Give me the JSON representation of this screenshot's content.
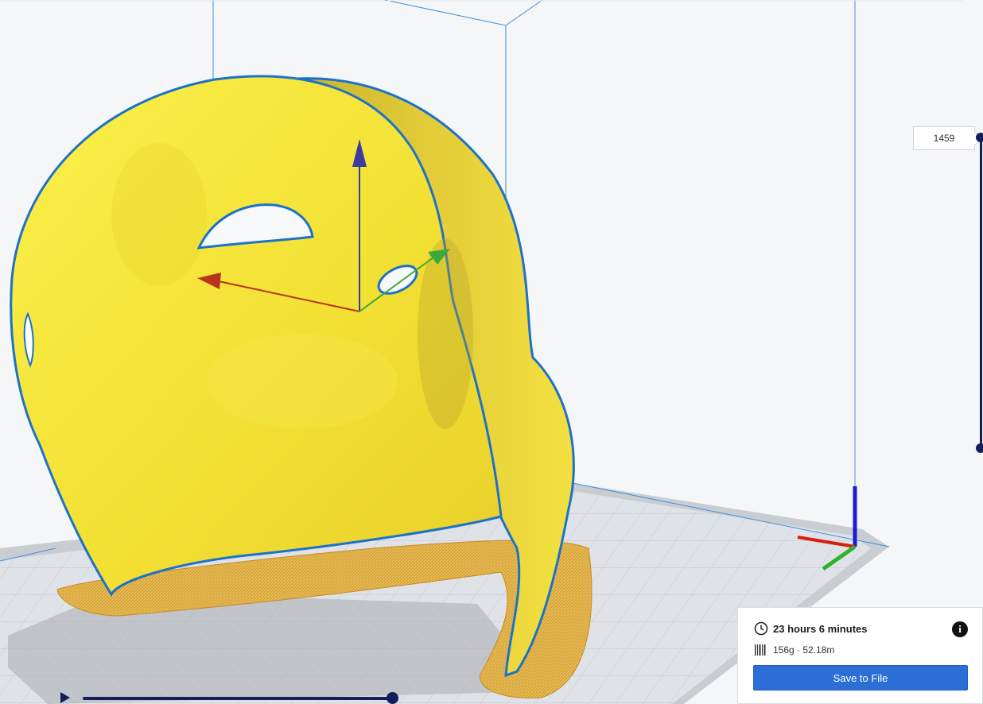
{
  "layer_slider": {
    "current_layer": "1459"
  },
  "print_info": {
    "time_icon": "clock-icon",
    "print_time": "23 hours 6 minutes",
    "info_icon": "info-icon",
    "material_icon": "filament-icon",
    "material_usage": "156g · 52.18m",
    "save_label": "Save to File"
  },
  "simulation": {
    "play_icon": "play-icon",
    "progress": 1.0
  },
  "colors": {
    "model_yellow": "#f4e536",
    "outline_blue": "#1c72c9",
    "axis_x": "#d4200c",
    "axis_y": "#2bb32b",
    "axis_z": "#1b1bd0",
    "accent": "#2b6fd6",
    "slider": "#141f5a"
  }
}
